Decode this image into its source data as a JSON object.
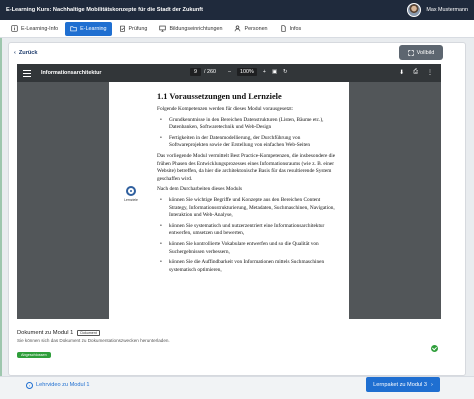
{
  "header": {
    "title": "E-Learning Kurs: Nachhaltige Mobilitätskonzepte für die Stadt der Zukunft",
    "user_name": "Max Mustermann"
  },
  "tabs": [
    {
      "label": "E-Learning-Info",
      "icon": "info-square-icon",
      "active": false
    },
    {
      "label": "E-Learning",
      "icon": "folder-icon",
      "active": true
    },
    {
      "label": "Prüfung",
      "icon": "clipboard-check-icon",
      "active": false
    },
    {
      "label": "Bildungseinrichtungen",
      "icon": "monitor-icon",
      "active": false
    },
    {
      "label": "Personen",
      "icon": "person-icon",
      "active": false
    },
    {
      "label": "Infos",
      "icon": "document-icon",
      "active": false
    }
  ],
  "content": {
    "back_label": "Zurück",
    "fullscreen_label": "Vollbild"
  },
  "viewer": {
    "doc_title": "Informationsarchitektur",
    "page_current": "9",
    "page_total": "/ 260",
    "zoom": "100%",
    "zoom_minus": "–",
    "zoom_plus": "+"
  },
  "page": {
    "heading": "1.1 Voraussetzungen und Lernziele",
    "intro": "Folgende Kompetenzen werden für dieses Modul vorausgesetzt:",
    "prereq_1": "Grundkenntnisse in den Bereichen Datenstrukturen (Listen, Bäume etc.), Datenbanken, Softwaretechnik und Web-Design",
    "prereq_2": "Fertigkeiten in der Datenmodellierung, der Durchführung von Softwareprojekten sowie der Erstellung von einfachen Web-Seiten",
    "para": "Das vorliegende Modul vermittelt Best Practice-Kompetenzen, die insbesondere die frühen Phasen des Entwicklungsprozesses eines Informationsraums (wie z. B. einer Website) betreffen, da hier die architektonische Basis für das resultierende System geschaffen wird.",
    "goals_intro": "Nach dem Durcharbeiten dieses Moduls",
    "goal_1": "können Sie wichtige Begriffe und Konzepte aus den Bereichen Content Strategy, Informationsstrukturierung, Metadaten, Suchmaschinen, Navigation, Interaktion und Web-Analyse,",
    "goal_2": "können Sie systematisch und nutzerzentriert eine Informationsarchitektur entwerfen, umsetzen und bewerten,",
    "goal_3": "können Sie kontrollierte Vokabulare entwerfen und so die Qualität von Suchergebnissen verbessern,",
    "goal_4": "können Sie die Auffindbarkeit von Informationen mittels Suchmaschinen systematisch optimieren,",
    "logo_label": "Lernziele"
  },
  "document": {
    "title": "Dokument zu Modul 1",
    "tag": "Dokument",
    "subtitle": "Sie können sich das Dokument zu Dokumentationszwecken herunterladen.",
    "status": "Abgeschlossen"
  },
  "footer": {
    "prev_label": "Lehrvideo zu Modul 1",
    "next_label": "Lernpaket zu Modul 3"
  }
}
